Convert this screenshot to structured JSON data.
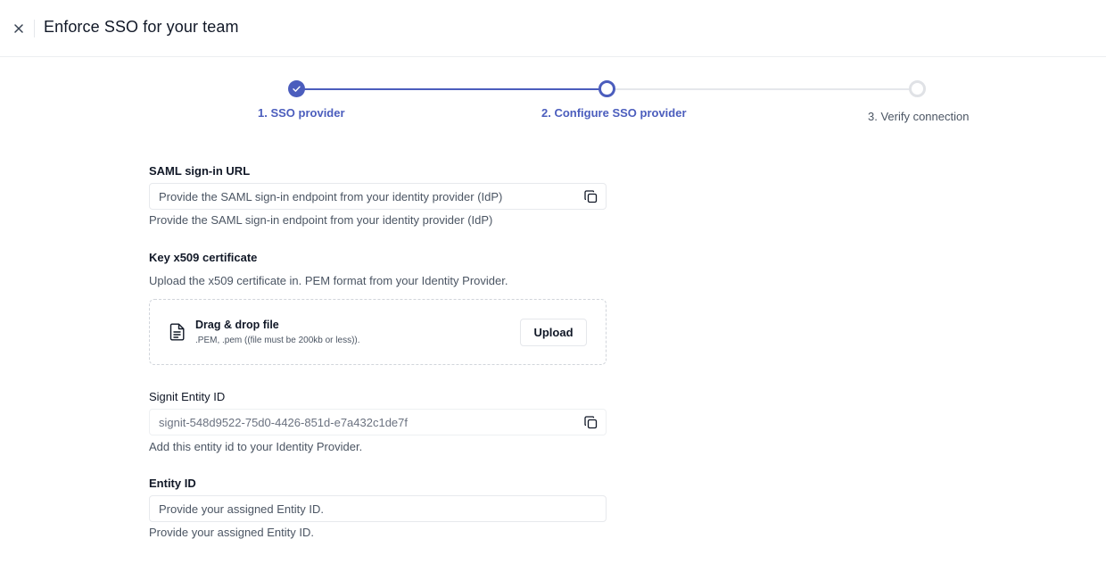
{
  "header": {
    "title": "Enforce SSO for your team"
  },
  "colors": {
    "accent": "#4b5dbd",
    "inactive": "#d1d5db",
    "text": "#1f2937"
  },
  "stepper": {
    "steps": [
      {
        "label": "1. SSO provider",
        "state": "complete"
      },
      {
        "label": "2. Configure SSO provider",
        "state": "current"
      },
      {
        "label": "3. Verify connection",
        "state": "upcoming"
      }
    ]
  },
  "form": {
    "saml": {
      "label": "SAML sign-in URL",
      "placeholder": "Provide the SAML sign-in endpoint from your identity provider (IdP)",
      "helper": "Provide the SAML sign-in endpoint from your identity provider (IdP)"
    },
    "cert": {
      "label": "Key x509 certificate",
      "helper": "Upload the x509 certificate in. PEM format from your Identity Provider.",
      "drop_title": "Drag & drop file",
      "drop_sub": ".PEM, .pem ((file must be 200kb or less)).",
      "upload_label": "Upload"
    },
    "signit_entity": {
      "label": "Signit Entity ID",
      "value": "signit-548d9522-75d0-4426-851d-e7a432c1de7f",
      "helper": "Add this entity id to your Identity Provider."
    },
    "entity": {
      "label": "Entity ID",
      "placeholder": "Provide your assigned Entity ID.",
      "helper": "Provide your assigned Entity ID."
    }
  }
}
